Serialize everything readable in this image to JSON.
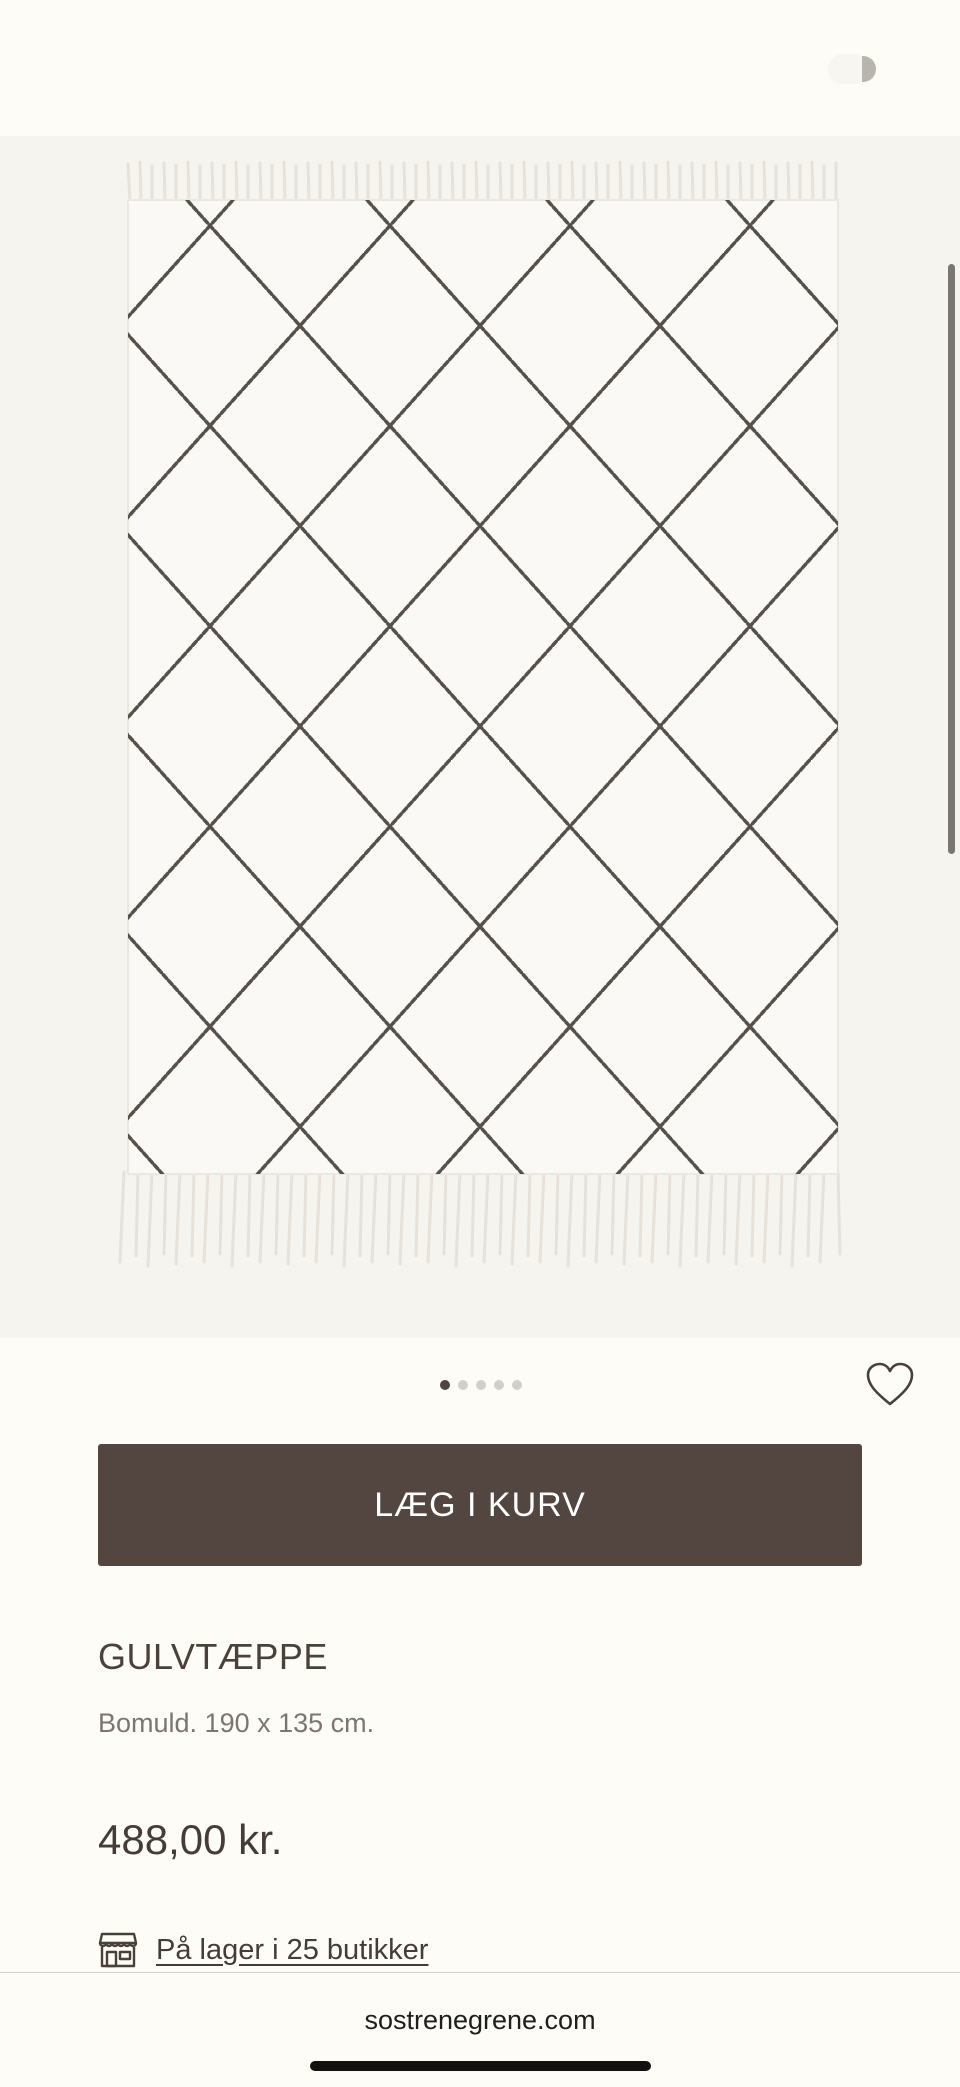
{
  "product": {
    "image_alt": "Gulvtæppe med sort diamantmønster",
    "carousel_total": 5,
    "carousel_active": 1,
    "add_to_cart_label": "LÆG I KURV",
    "title": "GULVTÆPPE",
    "description": "Bomuld. 190 x 135 cm.",
    "price": "488,00 kr.",
    "stock_label": "På lager i 25 butikker"
  },
  "browser": {
    "url": "sostrenegrene.com"
  },
  "icons": {
    "favorite": "heart-icon",
    "store": "store-icon"
  },
  "colors": {
    "page_background": "#fdfcf7",
    "hero_background": "#f6f4ef",
    "button_background": "#534640",
    "text_primary": "#463c37",
    "text_secondary": "#7d7570"
  }
}
